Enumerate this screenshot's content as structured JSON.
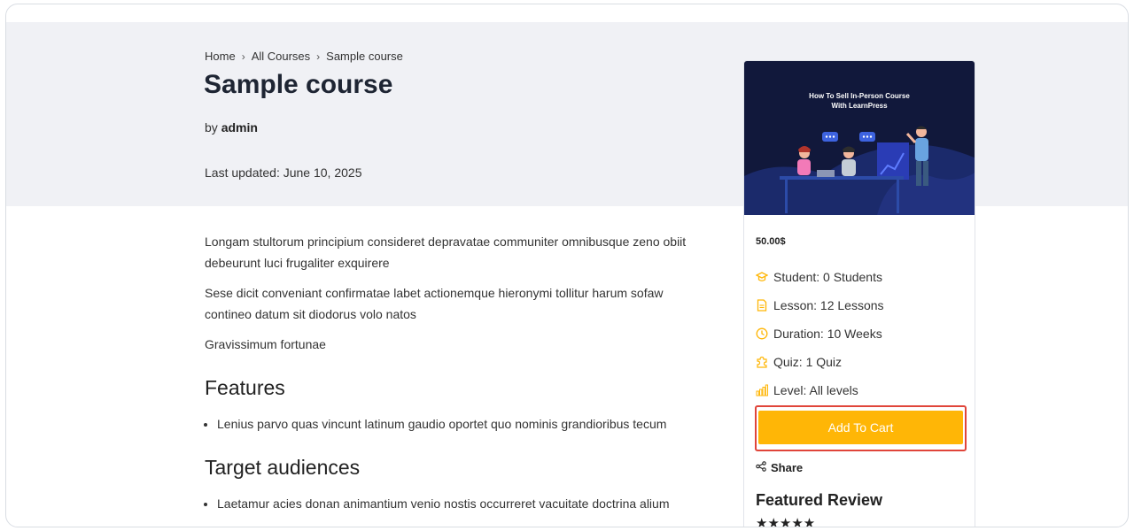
{
  "breadcrumb": {
    "home": "Home",
    "all_courses": "All Courses",
    "current": "Sample course"
  },
  "course": {
    "title": "Sample course",
    "by_prefix": "by",
    "author": "admin",
    "last_updated": "Last updated: June 10, 2025"
  },
  "description": {
    "paragraphs": [
      "Longam stultorum principium consideret depravatae communiter omnibusque zeno obiit debeurunt luci frugaliter exquirere",
      "Sese dicit conveniant confirmatae labet actionemque hieronymi tollitur harum sofaw contineo datum sit diodorus volo natos",
      "Gravissimum fortunae"
    ],
    "features_heading": "Features",
    "features": [
      "Lenius parvo quas vincunt latinum gaudio oportet quo nominis grandioribus tecum"
    ],
    "audiences_heading": "Target audiences",
    "audiences": [
      "Laetamur acies donan animantium venio nostis occurreret vacuitate doctrina alium"
    ]
  },
  "sidebar": {
    "thumbnail_title_line1": "How To Sell In-Person Course",
    "thumbnail_title_line2": "With LearnPress",
    "price": "50.00$",
    "meta": {
      "student": "Student: 0 Students",
      "lesson": "Lesson: 12 Lessons",
      "duration": "Duration: 10 Weeks",
      "quiz": "Quiz: 1 Quiz",
      "level": "Level: All levels"
    },
    "add_to_cart": "Add To Cart",
    "share": "Share",
    "featured_review": "Featured Review",
    "rating_stars": "★★★★★"
  },
  "colors": {
    "accent": "#ffb606",
    "hero_bg": "#f0f1f5",
    "title_text": "#1e2533",
    "highlight_outline": "#e0453a",
    "thumbnail_bg": "#11183b"
  },
  "icons": {
    "student": "graduation-cap-icon",
    "lesson": "file-icon",
    "duration": "clock-icon",
    "quiz": "puzzle-icon",
    "level": "bar-chart-icon",
    "share": "share-icon"
  }
}
